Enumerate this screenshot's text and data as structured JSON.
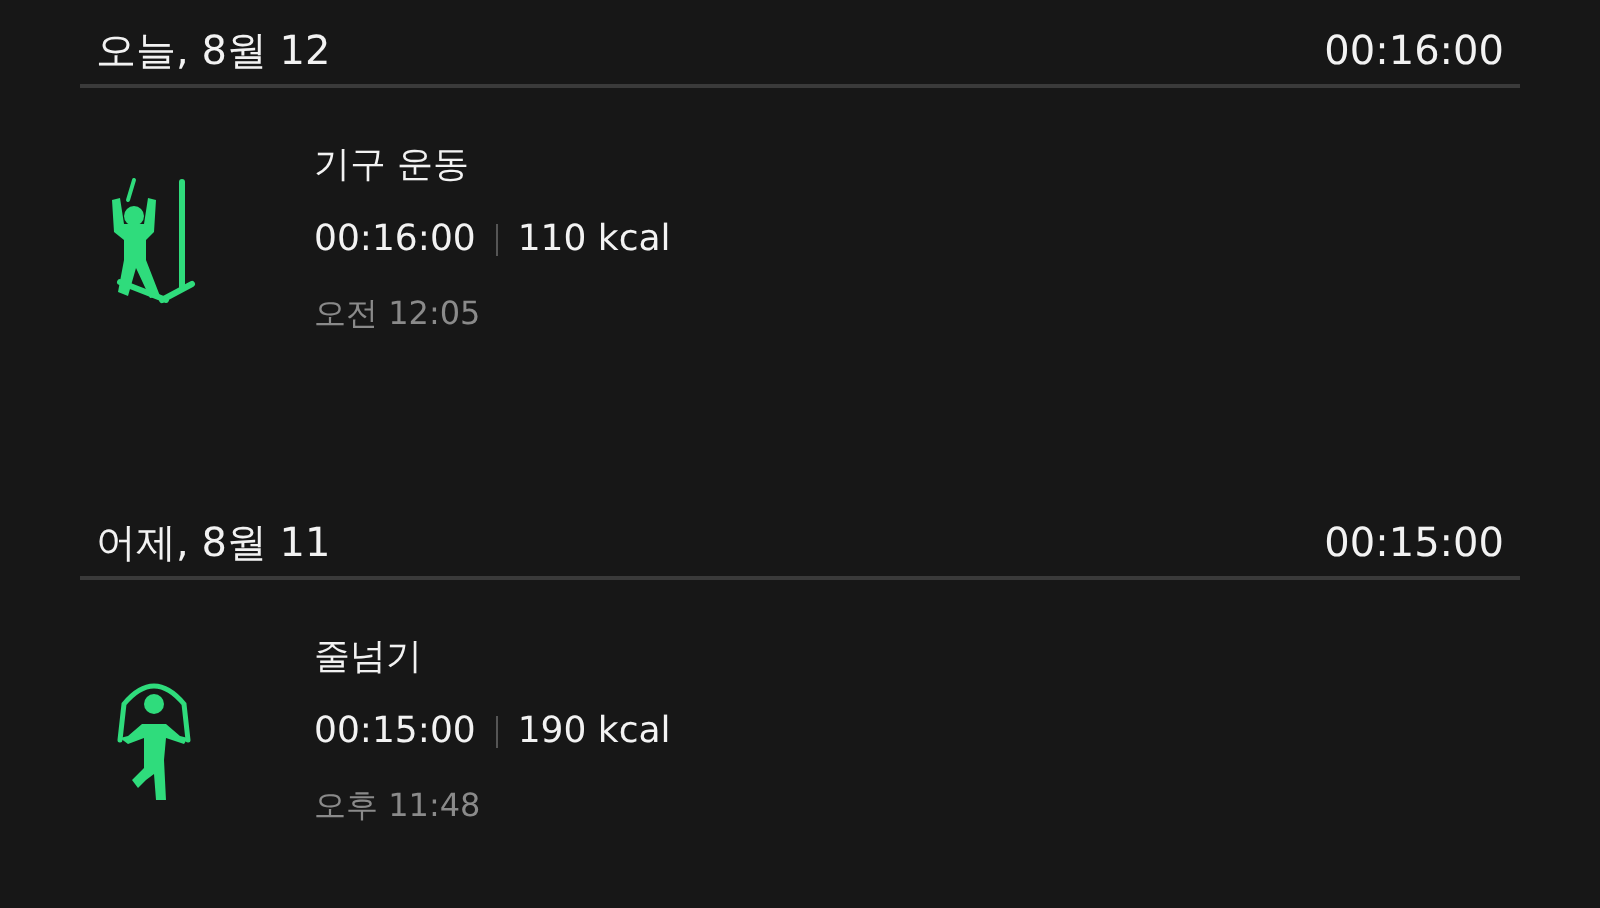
{
  "days": [
    {
      "date": "오늘, 8월 12",
      "total": "00:16:00",
      "entries": [
        {
          "kind": "machine",
          "name": "기구 운동",
          "duration": "00:16:00",
          "calories": "110 kcal",
          "time": "오전 12:05"
        }
      ]
    },
    {
      "date": "어제, 8월 11",
      "total": "00:15:00",
      "entries": [
        {
          "kind": "rope",
          "name": "줄넘기",
          "duration": "00:15:00",
          "calories": "190 kcal",
          "time": "오후 11:48"
        }
      ]
    }
  ]
}
